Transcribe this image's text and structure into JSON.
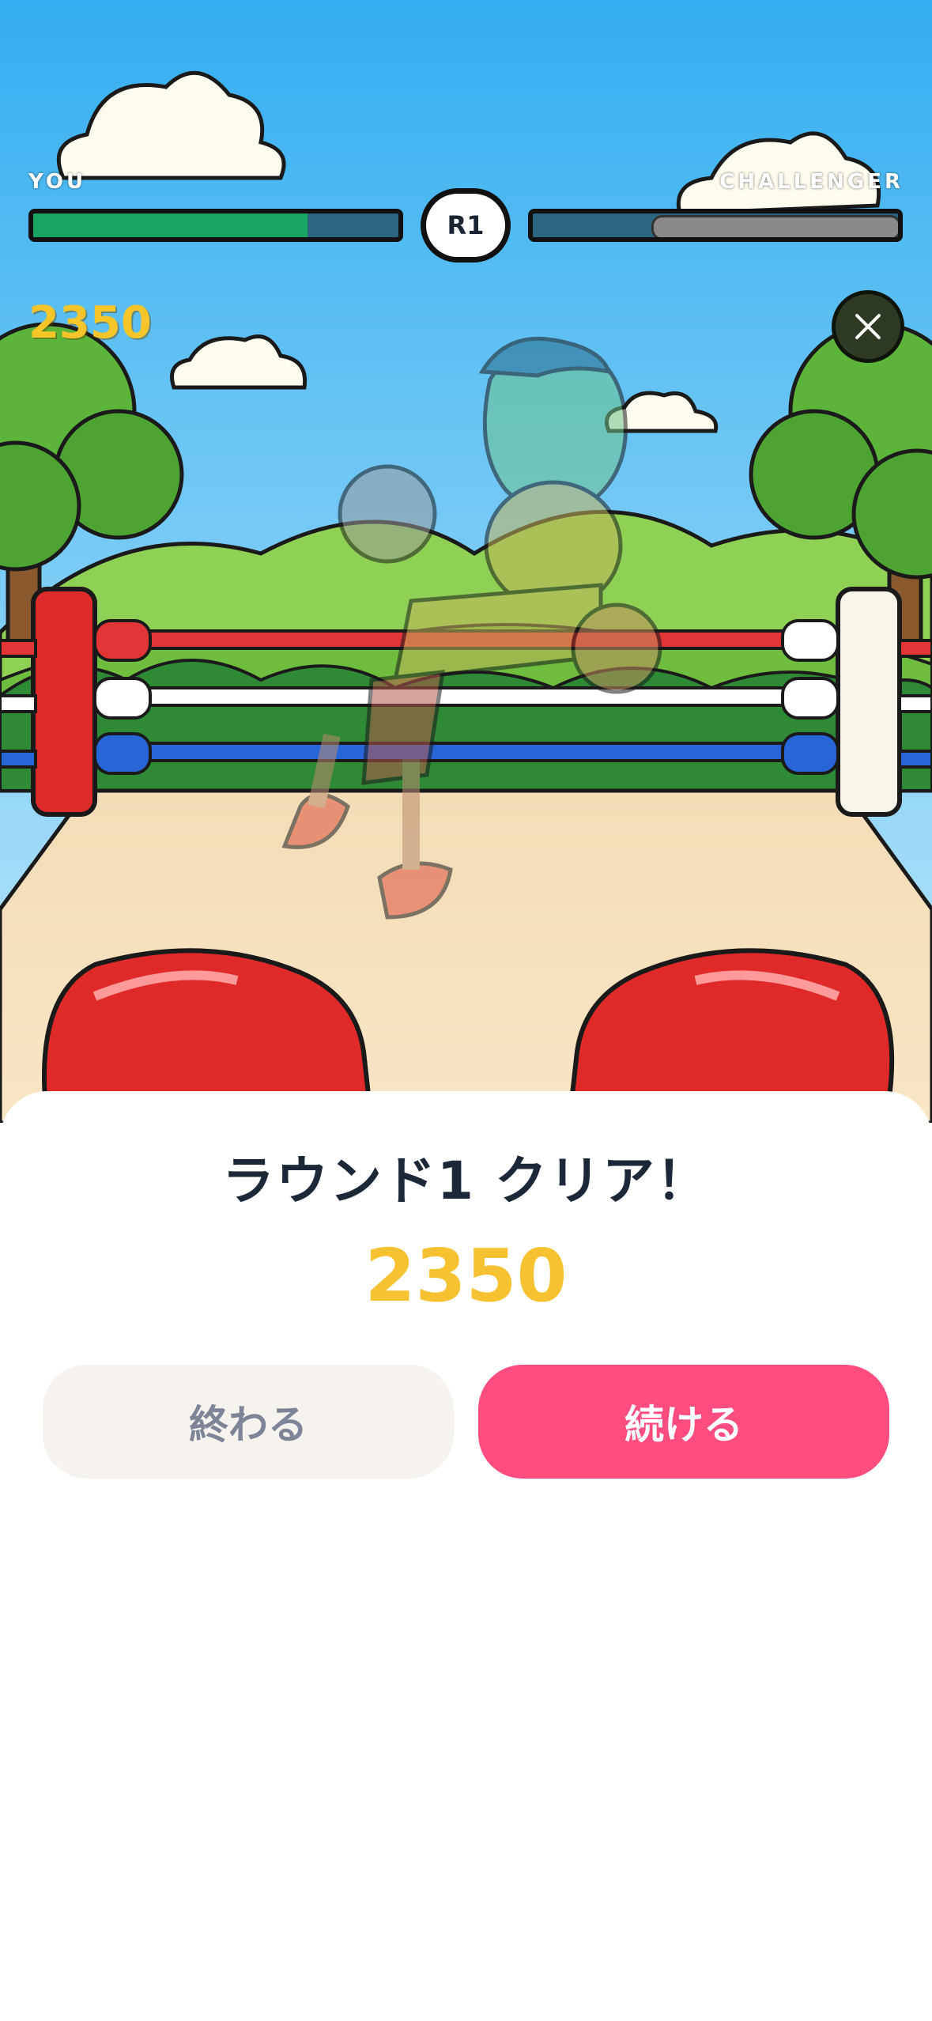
{
  "hud": {
    "player_label": "YOU",
    "opponent_label": "CHALLENGER",
    "round": "R1",
    "score": "2350",
    "player_hp_fraction": 0.75,
    "opponent_hp_fraction": 0.0,
    "player_hp_color": "#1aa464",
    "bar_bg_color": "#2d6680"
  },
  "result": {
    "title": "ラウンド1 クリア！",
    "score": "2350",
    "quit_label": "終わる",
    "continue_label": "続ける"
  },
  "icons": {
    "close": "close-icon"
  },
  "colors": {
    "sky": "#38b2f0",
    "score": "#f6c232",
    "continue_button": "#ff4d80",
    "quit_button": "#f6f3ef",
    "title_text": "#1c2738"
  }
}
